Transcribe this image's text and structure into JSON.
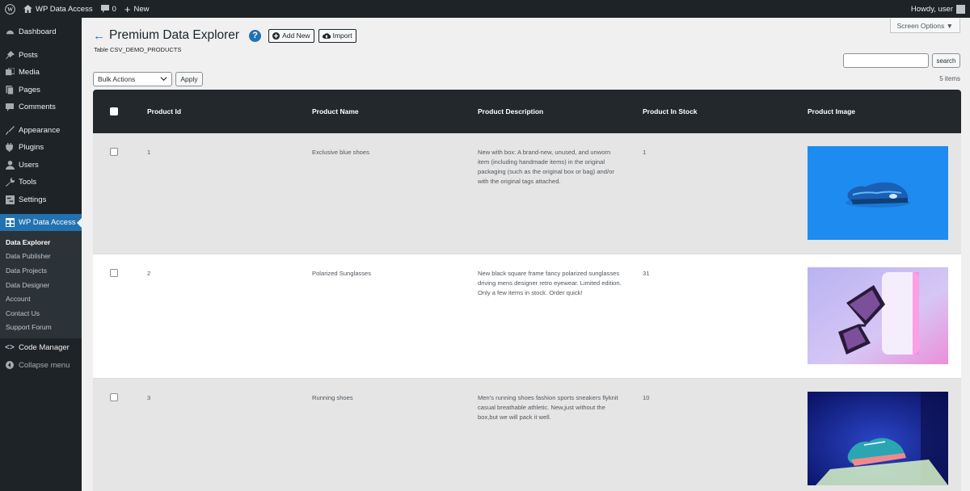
{
  "adminbar": {
    "site_name": "WP Data Access",
    "comments_count": "0",
    "new_label": "New",
    "howdy": "Howdy, user"
  },
  "sidebar": {
    "items": [
      {
        "label": "Dashboard",
        "icon": "dashboard-icon"
      },
      {
        "label": "Posts",
        "icon": "pin-icon"
      },
      {
        "label": "Media",
        "icon": "media-icon"
      },
      {
        "label": "Pages",
        "icon": "pages-icon"
      },
      {
        "label": "Comments",
        "icon": "comment-icon"
      },
      {
        "label": "Appearance",
        "icon": "brush-icon"
      },
      {
        "label": "Plugins",
        "icon": "plugin-icon"
      },
      {
        "label": "Users",
        "icon": "user-icon"
      },
      {
        "label": "Tools",
        "icon": "wrench-icon"
      },
      {
        "label": "Settings",
        "icon": "settings-icon"
      }
    ],
    "active": {
      "label": "WP Data Access",
      "icon": "table-icon"
    },
    "submenu": [
      "Data Explorer",
      "Data Publisher",
      "Data Projects",
      "Data Designer",
      "Account",
      "Contact Us",
      "Support Forum"
    ],
    "code_manager": "Code Manager",
    "collapse": "Collapse menu"
  },
  "header": {
    "screen_options": "Screen Options ▼",
    "title": "Premium Data Explorer",
    "add_new": "Add New",
    "import": "Import",
    "table_name": "Table CSV_DEMO_PRODUCTS"
  },
  "search": {
    "button": "search",
    "value": ""
  },
  "items_count": "5 items",
  "bulk": {
    "selected": "Bulk Actions",
    "apply": "Apply"
  },
  "table": {
    "columns": [
      "Product Id",
      "Product Name",
      "Product Description",
      "Product In Stock",
      "Product Image"
    ],
    "rows": [
      {
        "id": "1",
        "name": "Exclusive blue shoes",
        "description": "New with box: A brand-new, unused, and unworn item (including handmade items) in the original packaging (such as the original box or bag) and/or with the original tags attached.",
        "stock": "1",
        "image": "blue-sneaker-image"
      },
      {
        "id": "2",
        "name": "Polarized Sunglasses",
        "description": "New black square frame fancy polarized sunglasses driving mens designer retro eyewear. Limited edition. Only a few items in stock. Order quick!",
        "stock": "31",
        "image": "sunglasses-image"
      },
      {
        "id": "3",
        "name": "Running shoes",
        "description": "Men's running shoes fashion sports sneakers flyknit casual breathable athletic. New,just without the box,but we will pack it well.",
        "stock": "10",
        "image": "running-shoe-image"
      }
    ]
  },
  "colors": {
    "adminbar": "#1d2327",
    "accent": "#2271b1",
    "table_header": "#23282d",
    "row_alt": "#e5e5e5"
  }
}
